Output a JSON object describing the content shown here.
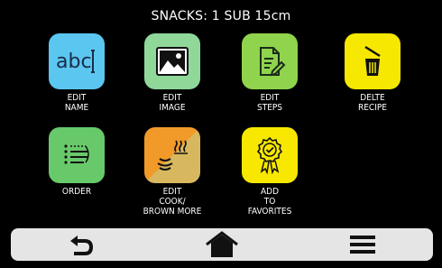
{
  "header": {
    "title": "SNACKS: 1 SUB 15cm"
  },
  "tiles": [
    {
      "label": "EDIT\nNAME",
      "icon": "text-cursor-icon",
      "color": "#5bc7f0"
    },
    {
      "label": "EDIT\nIMAGE",
      "icon": "image-icon",
      "color": "#8fd89a"
    },
    {
      "label": "EDIT\nSTEPS",
      "icon": "edit-document-icon",
      "color": "#8fd44c"
    },
    {
      "label": "DELTE\nRECIPE",
      "icon": "trash-icon",
      "color": "#f6e800"
    },
    {
      "label": "ORDER",
      "icon": "list-order-icon",
      "color": "#68c96a"
    },
    {
      "label": "EDIT\nCOOK/\nBROWN MORE",
      "icon": "heat-icon",
      "color_a": "#f19a2a",
      "color_b": "#d8b85f"
    },
    {
      "label": "ADD\nTO\nFAVORITES",
      "icon": "award-ribbon-icon",
      "color": "#f8e800"
    }
  ],
  "nav": {
    "back_icon": "back-arrow-icon",
    "home_icon": "home-icon",
    "menu_icon": "hamburger-menu-icon",
    "background": "#e5e5e5"
  }
}
